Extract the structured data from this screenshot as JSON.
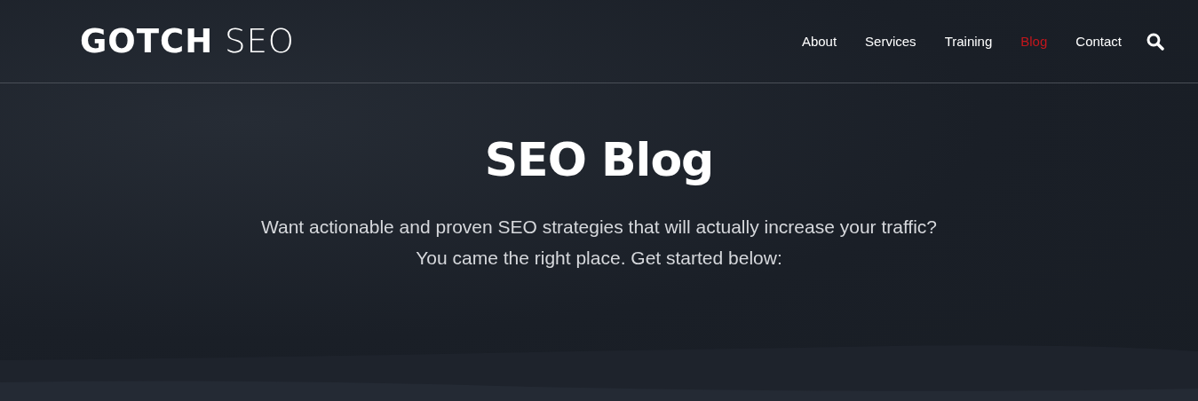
{
  "logo": "**GOTCH** SEO",
  "nav": [
    {
      "label": "About",
      "selected": false
    },
    {
      "label": "Services",
      "selected": false
    },
    {
      "label": "Training",
      "selected": false
    },
    {
      "label": "Blog",
      "selected": true
    },
    {
      "label": "Contact",
      "selected": false
    }
  ],
  "hero": {
    "title": "SEO Blog",
    "lines": [
      "Want actionable and proven SEO strategies that will actually increase your traffic?",
      "You came the right place. Get started below:"
    ]
  }
}
